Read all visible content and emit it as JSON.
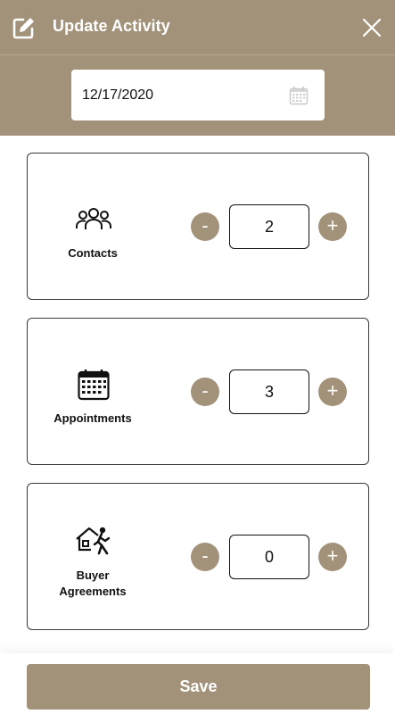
{
  "header": {
    "title": "Update Activity",
    "close_icon": "close-icon",
    "edit_icon": "edit-icon"
  },
  "date_field": {
    "value": "12/17/2020",
    "icon": "calendar-icon"
  },
  "activities": [
    {
      "label": "Contacts",
      "icon": "people-icon",
      "value": "2",
      "minus": "-",
      "plus": "+"
    },
    {
      "label": "Appointments",
      "icon": "calendar-icon",
      "value": "3",
      "minus": "-",
      "plus": "+"
    },
    {
      "label_line1": "Buyer",
      "label_line2": "Agreements",
      "icon": "buyer-house-icon",
      "value": "0",
      "minus": "-",
      "plus": "+"
    }
  ],
  "footer": {
    "save_label": "Save"
  },
  "colors": {
    "accent": "#a3927a",
    "text": "#111111",
    "background": "#ffffff"
  }
}
